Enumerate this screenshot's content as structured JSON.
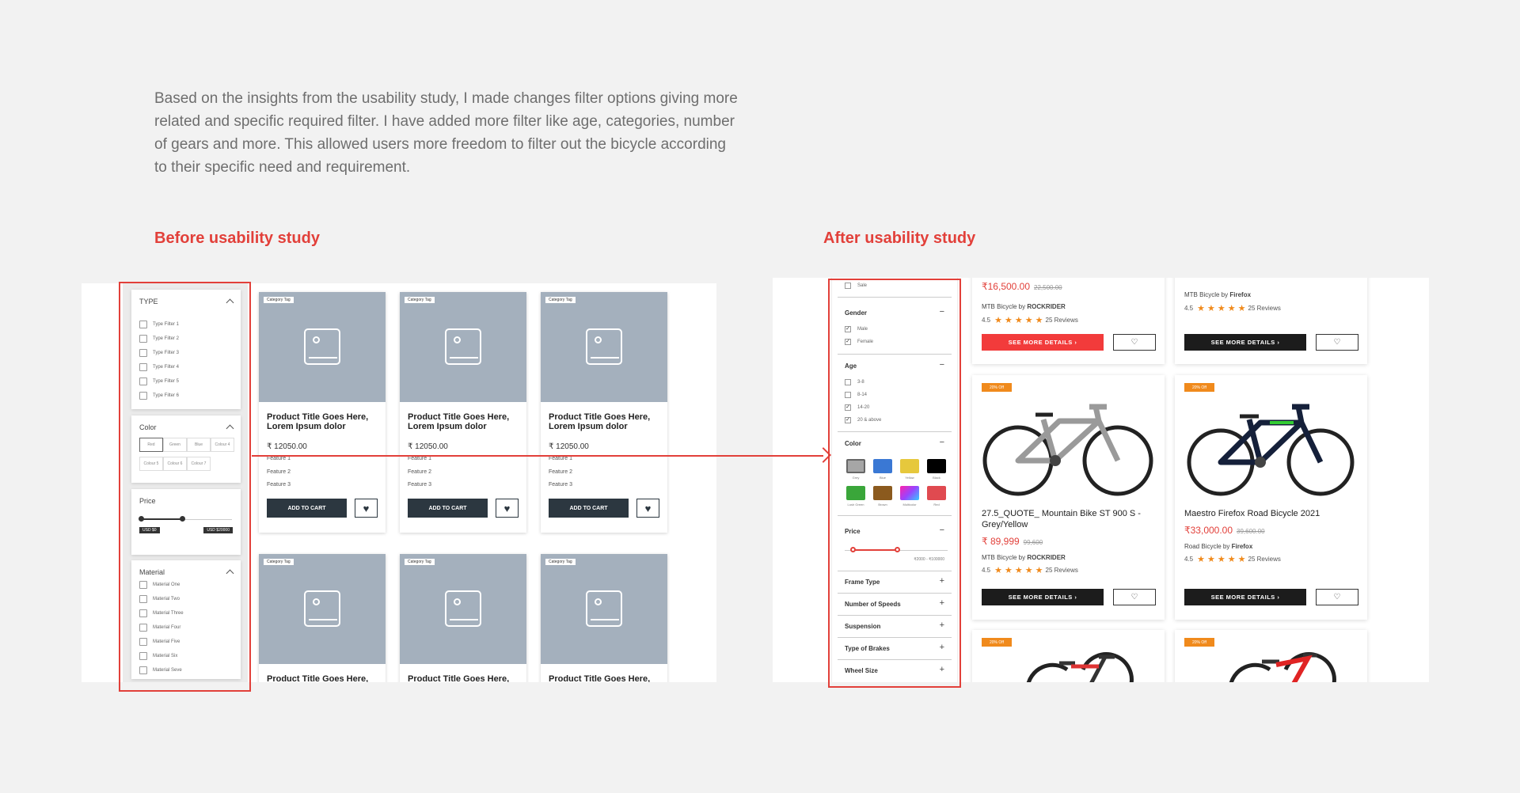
{
  "intro_text": "Based on the insights from the usability study, I made changes filter options giving more related and specific required filter. I have added more filter like age, categories, number of gears and more. This allowed users more freedom to filter out the bicycle  according to their specific need and requirement.",
  "before": {
    "heading": "Before usability study",
    "filters": {
      "type_title": "TYPE",
      "type_items": [
        "Type Filter 1",
        "Type Filter 2",
        "Type Filter 3",
        "Type Filter 4",
        "Type Filter 5",
        "Type Filter 6"
      ],
      "color_title": "Color",
      "colors": [
        "Red",
        "Green",
        "Blue",
        "Colour 4",
        "Colour 5",
        "Colour 6",
        "Colour 7"
      ],
      "price_title": "Price",
      "price_min": "USD $0",
      "price_max": "USD $20000",
      "material_title": "Material",
      "material_items": [
        "Material One",
        "Material Two",
        "Material Three",
        "Material Four",
        "Material Five",
        "Material Six",
        "Material Seve"
      ]
    },
    "product": {
      "tag": "Category Tag",
      "title": "Product Title Goes Here, Lorem Ipsum dolor",
      "price": "₹ 12050.00",
      "feature1": "Feature 1",
      "feature2": "Feature 2",
      "feature3": "Feature 3",
      "add_to_cart": "ADD TO CART"
    }
  },
  "after": {
    "heading": "After usability study",
    "filters": {
      "sale": "Sale",
      "gender_title": "Gender",
      "gender_items": [
        "Male",
        "Female"
      ],
      "age_title": "Age",
      "age_items": [
        "3-8",
        "8-14",
        "14-20",
        "20 & above"
      ],
      "color_title": "Color",
      "colors": [
        {
          "name": "Grey",
          "hex": "#a6a6a6"
        },
        {
          "name": "Blue",
          "hex": "#3a78d4"
        },
        {
          "name": "Yellow",
          "hex": "#e6c83c"
        },
        {
          "name": "Black",
          "hex": "#000000"
        },
        {
          "name": "Lush Green",
          "hex": "#3aa63a"
        },
        {
          "name": "Brown",
          "hex": "#8b5a1e"
        },
        {
          "name": "Multicolor",
          "hex": "#c07de0"
        },
        {
          "name": "Red",
          "hex": "#e04a50"
        }
      ],
      "price_title": "Price",
      "price_range": "₹2000 - ₹100000",
      "more": [
        "Frame Type",
        "Number of Speeds",
        "Suspension",
        "Type of Brakes",
        "Wheel Size"
      ]
    },
    "top_cards": [
      {
        "price": "₹16,500.00",
        "old": "22,500.00",
        "brand_prefix": "MTB Bicycle by",
        "brand": "ROCKRIDER",
        "rating": "4.5",
        "reviews": "25 Reviews",
        "button": "SEE MORE DETAILS  ›"
      },
      {
        "price": "",
        "old": "",
        "brand_prefix": "MTB Bicycle by",
        "brand": "Firefox",
        "rating": "4.5",
        "reviews": "25 Reviews",
        "button": "SEE MORE DETAILS  ›"
      }
    ],
    "cards": [
      {
        "badge": "20% Off",
        "name": "27.5_QUOTE_ Mountain Bike ST 900 S - Grey/Yellow",
        "price": "₹ 89,999",
        "old": "99,600",
        "brand_prefix": "MTB Bicycle by",
        "brand": "ROCKRIDER",
        "rating": "4.5",
        "reviews": "25 Reviews",
        "button": "SEE MORE DETAILS  ›"
      },
      {
        "badge": "20% Off",
        "name": "Maestro Firefox Road Bicycle 2021",
        "price": "₹33,000.00",
        "old": "39,600.00",
        "brand_prefix": "Road Bicycle by",
        "brand": "Firefox",
        "rating": "4.5",
        "reviews": "25 Reviews",
        "button": "SEE MORE DETAILS  ›"
      }
    ],
    "bottom_badges": [
      "20% Off",
      "20% Off"
    ]
  }
}
